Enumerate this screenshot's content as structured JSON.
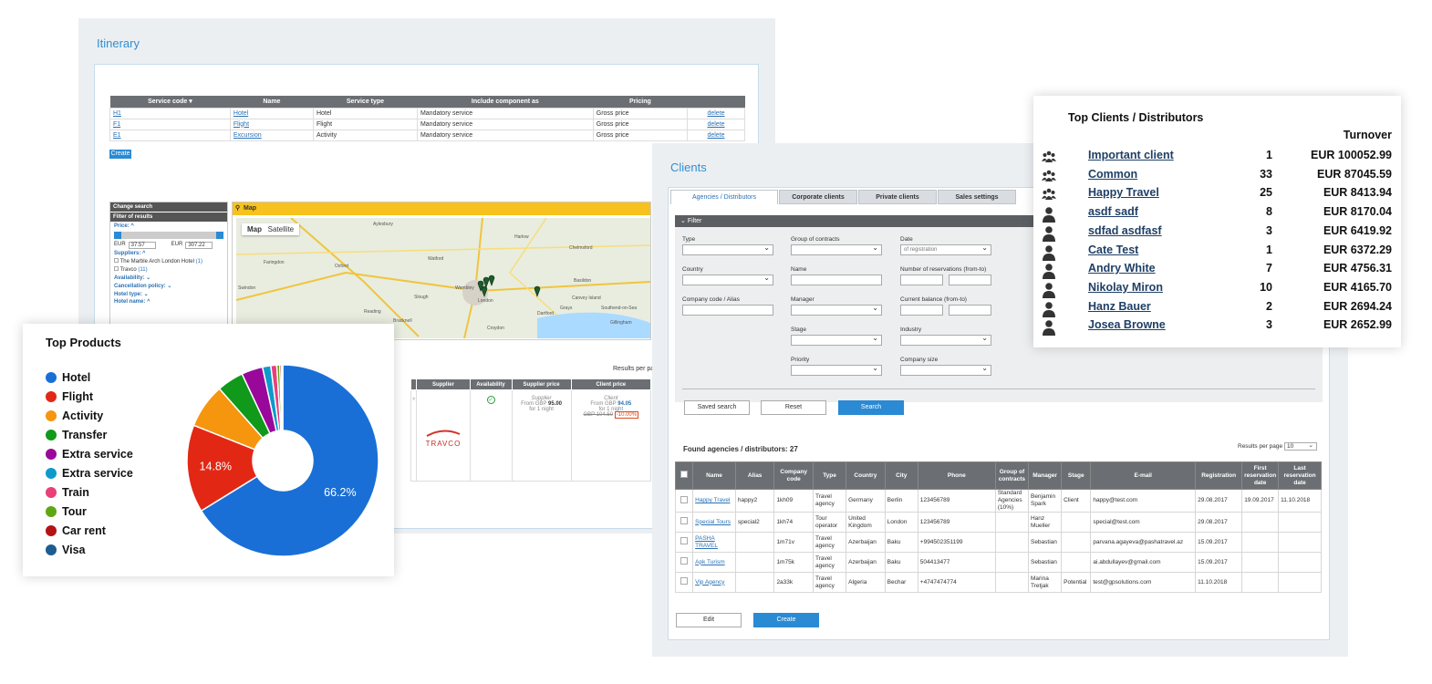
{
  "itinerary": {
    "title": "Itinerary",
    "table_headers": [
      "Service code ▾",
      "Name",
      "Service type",
      "Include component as",
      "Pricing",
      ""
    ],
    "rows": [
      {
        "code": "H1",
        "name": "Hotel",
        "type": "Hotel",
        "include": "Mandatory service",
        "pricing": "Gross price",
        "action": "delete"
      },
      {
        "code": "F1",
        "name": "Flight",
        "type": "Flight",
        "include": "Mandatory service",
        "pricing": "Gross price",
        "action": "delete"
      },
      {
        "code": "E1",
        "name": "Excursion",
        "type": "Activity",
        "include": "Mandatory service",
        "pricing": "Gross price",
        "action": "delete"
      }
    ],
    "create_label": "Create",
    "side": {
      "change_search": "Change search",
      "filter_results": "Filter of results",
      "price_label": "Price: ^",
      "price_min_cur": "EUR",
      "price_min": "37.57",
      "price_max_cur": "EUR",
      "price_max": "307.22",
      "suppliers_label": "Suppliers: ^",
      "supplier1": "The Marble Arch London Hotel",
      "supplier1_count": "(1)",
      "supplier2": "Travco",
      "supplier2_count": "(11)",
      "availability": "Availability: ⌄",
      "cancellation": "Cancellation policy: ⌄",
      "hotel_type": "Hotel type: ⌄",
      "hotel_name": "Hotel name: ^"
    },
    "map": {
      "bar_label": "Map",
      "tab_map": "Map",
      "tab_satellite": "Satellite",
      "towns": [
        "Aylesbury",
        "Harlow",
        "Chelmsford",
        "Oxford",
        "Watford",
        "Basildon",
        "Slough",
        "Wembley",
        "London",
        "Canvey Island",
        "Reading",
        "Bracknell",
        "Dartford",
        "Southend-on-Sea",
        "Croydon",
        "Swindon",
        "Faringdon",
        "Grays",
        "Gillingham"
      ]
    },
    "results_per_page": "Results per page:",
    "results_headers": [
      "Supplier",
      "Availability",
      "Supplier price",
      "Client price"
    ],
    "supplier_logo": "TRAVCO",
    "supplier_price": {
      "label": "Supplier",
      "from": "From GBP",
      "amount": "95.00",
      "nights": "for 1 night"
    },
    "client_price": {
      "label": "Client",
      "from": "From GBP",
      "amount": "94.05",
      "nights": "for 1 night",
      "old": "GBP 104.50",
      "discount": "-10.00%"
    }
  },
  "clients": {
    "title": "Clients",
    "tabs": [
      "Agencies / Distributors",
      "Corporate clients",
      "Private clients",
      "Sales settings"
    ],
    "filter_label": "Filter",
    "fields": {
      "type": "Type",
      "group": "Group of contracts",
      "date": "Date",
      "date_value": "of registration",
      "country": "Country",
      "name": "Name",
      "num_res": "Number of reservations (from-to)",
      "company_code": "Company code / Alias",
      "manager": "Manager",
      "balance": "Current balance (from-to)",
      "stage": "Stage",
      "industry": "Industry",
      "priority": "Priority",
      "company_size": "Company size"
    },
    "buttons": {
      "saved": "Saved search",
      "reset": "Reset",
      "search": "Search",
      "edit": "Edit",
      "create": "Create"
    },
    "found_label": "Found agencies / distributors: 27",
    "rpp_label": "Results per page",
    "rpp_value": "10",
    "table_headers": [
      "",
      "Name",
      "Alias",
      "Company code",
      "Type",
      "Country",
      "City",
      "Phone",
      "Group of contracts",
      "Manager",
      "Stage",
      "E-mail",
      "Registration",
      "First reservation date",
      "Last reservation date"
    ],
    "rows": [
      {
        "name": "Happy Travel",
        "alias": "happy2",
        "code": "1kh09",
        "type": "Travel agency",
        "country": "Germany",
        "city": "Berlin",
        "phone": "123456789",
        "group": "Standard Agencies (10%)",
        "manager": "Benjamin Spark",
        "stage": "Client",
        "email": "happy@test.com",
        "reg": "29.08.2017",
        "first": "19.09.2017",
        "last": "11.10.2018"
      },
      {
        "name": "Special Tours",
        "alias": "special2",
        "code": "1kh74",
        "type": "Tour operator",
        "country": "United Kingdom",
        "city": "London",
        "phone": "123456789",
        "group": "",
        "manager": "Hanz Mueller",
        "stage": "",
        "email": "special@test.com",
        "reg": "29.08.2017",
        "first": "",
        "last": ""
      },
      {
        "name": "PASHA TRAVEL",
        "alias": "",
        "code": "1m71v",
        "type": "Travel agency",
        "country": "Azerbaijan",
        "city": "Baku",
        "phone": "+994502351199",
        "group": "",
        "manager": "Sebastian",
        "stage": "",
        "email": "parvana.agayeva@pashatravel.az",
        "reg": "15.09.2017",
        "first": "",
        "last": ""
      },
      {
        "name": "Apk Turism",
        "alias": "",
        "code": "1m75k",
        "type": "Travel agency",
        "country": "Azerbaijan",
        "city": "Baku",
        "phone": "504413477",
        "group": "",
        "manager": "Sebastian",
        "stage": "",
        "email": "ai.abdullayev@gmail.com",
        "reg": "15.09.2017",
        "first": "",
        "last": ""
      },
      {
        "name": "Vip Agency",
        "alias": "",
        "code": "2a33k",
        "type": "Travel agency",
        "country": "Algeria",
        "city": "Bechar",
        "phone": "+4747474774",
        "group": "",
        "manager": "Marina Tretjak",
        "stage": "Potential",
        "email": "test@gpsolutions.com",
        "reg": "11.10.2018",
        "first": "",
        "last": ""
      }
    ]
  },
  "top_products": {
    "title": "Top Products",
    "labels": {
      "big": "66.2%",
      "flight": "14.8%"
    },
    "chart_data": {
      "type": "pie",
      "categories": [
        "Hotel",
        "Flight",
        "Activity",
        "Transfer",
        "Extra service",
        "Extra service",
        "Train",
        "Tour",
        "Car rent",
        "Visa"
      ],
      "values": [
        66.2,
        14.8,
        7.5,
        4.5,
        3.6,
        1.4,
        1.0,
        0.5,
        0.3,
        0.2
      ],
      "colors": [
        "#1a6fd6",
        "#e22814",
        "#f6950e",
        "#10991a",
        "#99089b",
        "#0d9acb",
        "#e93f7b",
        "#5fa711",
        "#b31316",
        "#1b5c91"
      ],
      "donut": true
    }
  },
  "top_clients": {
    "title": "Top Clients / Distributors",
    "turnover_label": "Turnover",
    "rows": [
      {
        "icon": "group-icon",
        "name": "Important client",
        "count": "1",
        "turnover": "EUR 100052.99"
      },
      {
        "icon": "group-icon",
        "name": "Common",
        "count": "33",
        "turnover": "EUR 87045.59"
      },
      {
        "icon": "group-icon",
        "name": "Happy Travel",
        "count": "25",
        "turnover": "EUR 8413.94"
      },
      {
        "icon": "person-icon",
        "name": "asdf sadf",
        "count": "8",
        "turnover": "EUR 8170.04"
      },
      {
        "icon": "person-icon",
        "name": "sdfad asdfasf",
        "count": "3",
        "turnover": "EUR 6419.92"
      },
      {
        "icon": "person-icon",
        "name": "Cate Test",
        "count": "1",
        "turnover": "EUR 6372.29"
      },
      {
        "icon": "person-icon",
        "name": "Andry White",
        "count": "7",
        "turnover": "EUR 4756.31"
      },
      {
        "icon": "person-icon",
        "name": "Nikolay Miron",
        "count": "10",
        "turnover": "EUR 4165.70"
      },
      {
        "icon": "person-icon",
        "name": "Hanz Bauer",
        "count": "2",
        "turnover": "EUR 2694.24"
      },
      {
        "icon": "person-icon",
        "name": "Josea Browne",
        "count": "3",
        "turnover": "EUR 2652.99"
      }
    ]
  }
}
